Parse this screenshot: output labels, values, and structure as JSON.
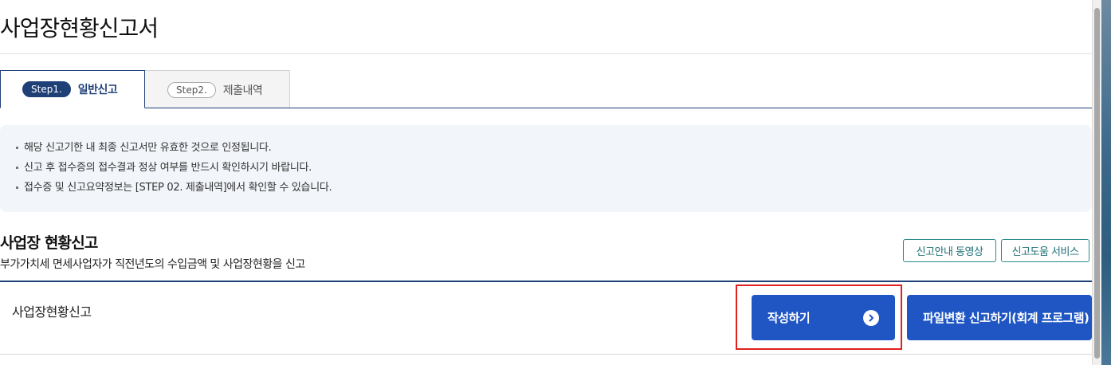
{
  "page": {
    "title": "사업장현황신고서"
  },
  "tabs": [
    {
      "step": "Step1.",
      "label": "일반신고",
      "active": true
    },
    {
      "step": "Step2.",
      "label": "제출내역",
      "active": false
    }
  ],
  "notice": {
    "items": [
      "해당 신고기한 내 최종 신고서만 유효한 것으로 인정됩니다.",
      "신고 후 접수증의 접수결과 정상 여부를 반드시 확인하시기 바랍니다.",
      "접수증 및 신고요약정보는 [STEP 02. 제출내역]에서 확인할 수 있습니다."
    ]
  },
  "section": {
    "title": "사업장 현황신고",
    "description": "부가가치세 면세사업자가 직전년도의 수입금액 및 사업장현황을 신고",
    "video_button": "신고안내 동영상",
    "help_button": "신고도움 서비스",
    "row_label": "사업장현황신고",
    "write_button": "작성하기",
    "file_button": "파일변환 신고하기(회계 프로그램)"
  },
  "colors": {
    "navy": "#1f3f77",
    "primary_button": "#1f56c4",
    "teal_outline": "#2a8a8a",
    "highlight": "#e02020",
    "notice_bg": "#f2f5f9"
  },
  "icons": {
    "write_button_icon": "chevron-right-circle-icon"
  }
}
